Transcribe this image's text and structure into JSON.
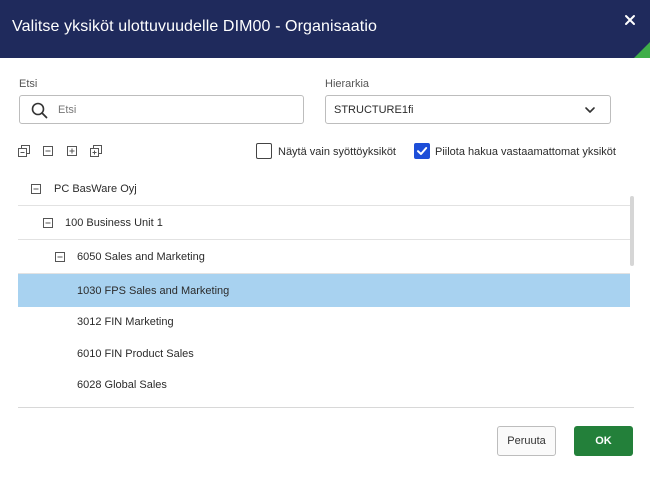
{
  "dialog": {
    "title": "Valitse yksiköt ulottuvuudelle DIM00 - Organisaatio",
    "accent_color": "#1f2a5c",
    "brand_green": "#3fae49"
  },
  "search": {
    "label": "Etsi",
    "placeholder": "Etsi",
    "value": ""
  },
  "hierarchy": {
    "label": "Hierarkia",
    "selected": "STRUCTURE1fi"
  },
  "toolbar": {
    "icons": [
      "expand-all-icon",
      "collapse-icon",
      "expand-icon",
      "collapse-all-icon"
    ]
  },
  "filters": {
    "input_units_only": {
      "label": "Näytä vain syöttöyksiköt",
      "checked": false
    },
    "hide_non_matching": {
      "label": "Piilota hakua vastaamattomat yksiköt",
      "checked": true
    }
  },
  "tree": {
    "rows": [
      {
        "label": "PC BasWare Oyj",
        "level": 0,
        "expander": "collapse",
        "selected": false
      },
      {
        "label": "100 Business Unit 1",
        "level": 1,
        "expander": "collapse",
        "selected": false
      },
      {
        "label": "6050 Sales and Marketing",
        "level": 2,
        "expander": "collapse",
        "selected": false
      },
      {
        "label": "1030 FPS Sales and Marketing",
        "level": 3,
        "expander": "none",
        "selected": true
      },
      {
        "label": "3012 FIN Marketing",
        "level": 3,
        "expander": "none",
        "selected": false
      },
      {
        "label": "6010 FIN Product Sales",
        "level": 3,
        "expander": "none",
        "selected": false
      },
      {
        "label": "6028 Global Sales",
        "level": 3,
        "expander": "none",
        "selected": false
      }
    ],
    "selected_color": "#a8d2f0"
  },
  "footer": {
    "cancel_label": "Peruuta",
    "ok_label": "OK",
    "ok_color": "#23803a"
  }
}
